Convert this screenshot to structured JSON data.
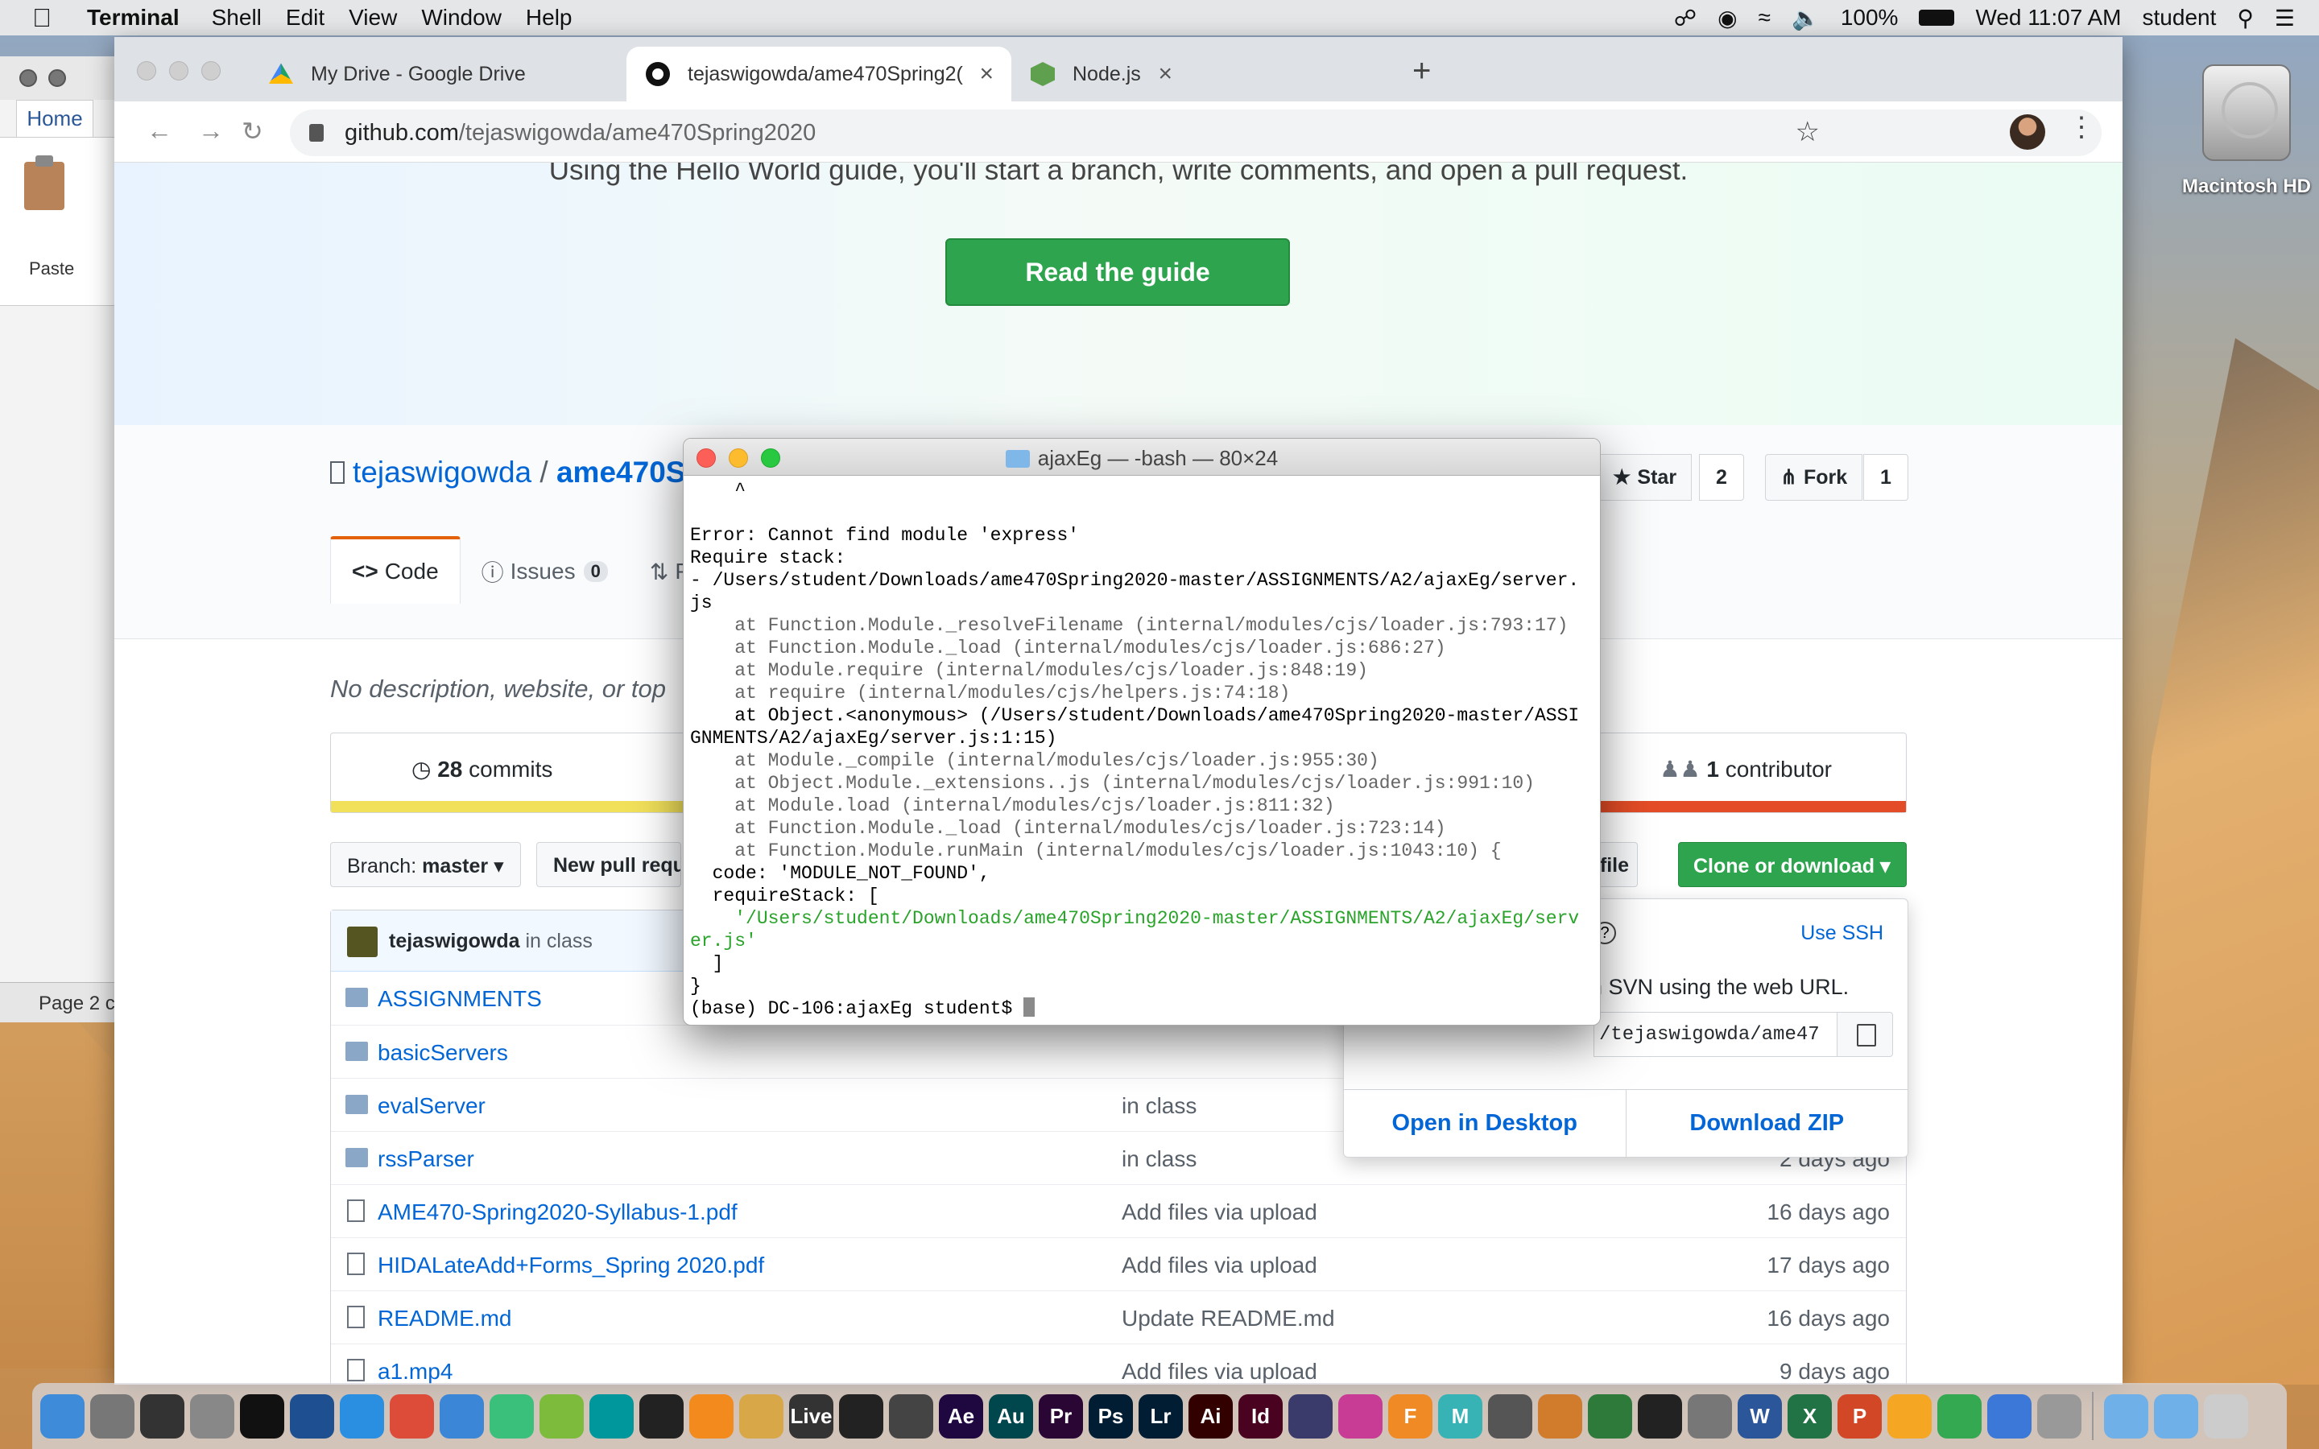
{
  "menubar": {
    "app": "Terminal",
    "items": [
      "Shell",
      "Edit",
      "View",
      "Window",
      "Help"
    ],
    "battery": "100%",
    "clock": "Wed 11:07 AM",
    "user": "student"
  },
  "word": {
    "home_tab": "Home",
    "paste": "Paste",
    "page_label": "Page 2 c"
  },
  "desktop": {
    "hd_label": "Macintosh HD"
  },
  "browser": {
    "tabs": [
      {
        "title": "My Drive - Google Drive"
      },
      {
        "title": "tejaswigowda/ame470Spring2("
      },
      {
        "title": "Node.js"
      }
    ],
    "url_host": "github.com",
    "url_path": "/tejaswigowda/ame470Spring2020"
  },
  "github": {
    "hero_sub": "Using the Hello World guide, you'll start a branch, write comments, and open a pull request.",
    "guide_button": "Read the guide",
    "owner": "tejaswigowda",
    "slash": "/",
    "repo_partial": "ame470S",
    "star_label": "Star",
    "star_count": "2",
    "fork_label": "Fork",
    "fork_count": "1",
    "tabs": {
      "code": "Code",
      "issues": "Issues",
      "issues_count": "0",
      "pulls_partial": "P"
    },
    "description": "No description, website, or top",
    "commits_count": "28",
    "commits_label": "commits",
    "contrib_count": "1",
    "contrib_label": "contributor",
    "branch_label": "Branch:",
    "branch_name": "master",
    "new_pr": "New pull requ",
    "find_file": "d file",
    "clone_button": "Clone or download",
    "commit_author": "tejaswigowda",
    "commit_msg": "in class",
    "files": [
      {
        "name": "ASSIGNMENTS",
        "type": "dir",
        "msg": "",
        "age": ""
      },
      {
        "name": "basicServers",
        "type": "dir",
        "msg": "",
        "age": ""
      },
      {
        "name": "evalServer",
        "type": "dir",
        "msg": "in class",
        "age": ""
      },
      {
        "name": "rssParser",
        "type": "dir",
        "msg": "in class",
        "age": "2 days ago"
      },
      {
        "name": "AME470-Spring2020-Syllabus-1.pdf",
        "type": "file",
        "msg": "Add files via upload",
        "age": "16 days ago"
      },
      {
        "name": "HIDALateAdd+Forms_Spring 2020.pdf",
        "type": "file",
        "msg": "Add files via upload",
        "age": "17 days ago"
      },
      {
        "name": "README.md",
        "type": "file",
        "msg": "Update README.md",
        "age": "16 days ago"
      },
      {
        "name": "a1.mp4",
        "type": "file",
        "msg": "Add files via upload",
        "age": "9 days ago"
      }
    ],
    "clone": {
      "use_ssh": "Use SSH",
      "svn_text": "n SVN using the web URL.",
      "url_value": "/tejaswigowda/ame47",
      "open_desktop": "Open in Desktop",
      "download_zip": "Download ZIP"
    },
    "lang_colors": [
      "#f1e05a",
      "#e34c26"
    ]
  },
  "terminal": {
    "title": "ajaxEg — -bash — 80×24",
    "lines": [
      {
        "t": "    ^",
        "c": ""
      },
      {
        "t": "",
        "c": ""
      },
      {
        "t": "Error: Cannot find module 'express'",
        "c": ""
      },
      {
        "t": "Require stack:",
        "c": ""
      },
      {
        "t": "- /Users/student/Downloads/ame470Spring2020-master/ASSIGNMENTS/A2/ajaxEg/server.",
        "c": ""
      },
      {
        "t": "js",
        "c": ""
      },
      {
        "t": "    at Function.Module._resolveFilename (internal/modules/cjs/loader.js:793:17)",
        "c": "gray"
      },
      {
        "t": "    at Function.Module._load (internal/modules/cjs/loader.js:686:27)",
        "c": "gray"
      },
      {
        "t": "    at Module.require (internal/modules/cjs/loader.js:848:19)",
        "c": "gray"
      },
      {
        "t": "    at require (internal/modules/cjs/helpers.js:74:18)",
        "c": "gray"
      },
      {
        "t": "    at Object.<anonymous> (/Users/student/Downloads/ame470Spring2020-master/ASSI",
        "c": ""
      },
      {
        "t": "GNMENTS/A2/ajaxEg/server.js:1:15)",
        "c": ""
      },
      {
        "t": "    at Module._compile (internal/modules/cjs/loader.js:955:30)",
        "c": "gray"
      },
      {
        "t": "    at Object.Module._extensions..js (internal/modules/cjs/loader.js:991:10)",
        "c": "gray"
      },
      {
        "t": "    at Module.load (internal/modules/cjs/loader.js:811:32)",
        "c": "gray"
      },
      {
        "t": "    at Function.Module._load (internal/modules/cjs/loader.js:723:14)",
        "c": "gray"
      },
      {
        "t": "    at Function.Module.runMain (internal/modules/cjs/loader.js:1043:10) {",
        "c": "gray"
      },
      {
        "t": "  code: 'MODULE_NOT_FOUND',",
        "c": ""
      },
      {
        "t": "  requireStack: [",
        "c": ""
      },
      {
        "t": "    '/Users/student/Downloads/ame470Spring2020-master/ASSIGNMENTS/A2/ajaxEg/serv",
        "c": "green"
      },
      {
        "t": "er.js'",
        "c": "green"
      },
      {
        "t": "  ]",
        "c": ""
      },
      {
        "t": "}",
        "c": ""
      }
    ],
    "prompt": "(base) DC-106:ajaxEg student$ "
  },
  "dock": [
    {
      "name": "finder",
      "color": "#3d8bd9",
      "label": ""
    },
    {
      "name": "launchpad",
      "color": "#777777",
      "label": ""
    },
    {
      "name": "mission-control",
      "color": "#333333",
      "label": ""
    },
    {
      "name": "system-preferences",
      "color": "#888888",
      "label": ""
    },
    {
      "name": "terminal",
      "color": "#111111",
      "label": ""
    },
    {
      "name": "sourcetree",
      "color": "#1d4f91",
      "label": ""
    },
    {
      "name": "safari",
      "color": "#2a8fe0",
      "label": ""
    },
    {
      "name": "chrome",
      "color": "#dd4b39",
      "label": ""
    },
    {
      "name": "xcode",
      "color": "#3b86d6",
      "label": ""
    },
    {
      "name": "atom",
      "color": "#3ac07b",
      "label": ""
    },
    {
      "name": "android-studio",
      "color": "#7dbb3d",
      "label": ""
    },
    {
      "name": "arduino",
      "color": "#00979c",
      "label": ""
    },
    {
      "name": "processing",
      "color": "#222222",
      "label": ""
    },
    {
      "name": "vlc",
      "color": "#f28a1e",
      "label": ""
    },
    {
      "name": "cyberduck",
      "color": "#d8a848",
      "label": ""
    },
    {
      "name": "ableton-live",
      "color": "#333333",
      "label": "Live"
    },
    {
      "name": "unity",
      "color": "#222222",
      "label": ""
    },
    {
      "name": "max",
      "color": "#444444",
      "label": ""
    },
    {
      "name": "after-effects",
      "color": "#1f0740",
      "label": "Ae"
    },
    {
      "name": "audition",
      "color": "#00474d",
      "label": "Au"
    },
    {
      "name": "premiere",
      "color": "#2a0634",
      "label": "Pr"
    },
    {
      "name": "photoshop",
      "color": "#001d34",
      "label": "Ps"
    },
    {
      "name": "lightroom",
      "color": "#001d34",
      "label": "Lr"
    },
    {
      "name": "illustrator",
      "color": "#330000",
      "label": "Ai"
    },
    {
      "name": "indesign",
      "color": "#49021f",
      "label": "Id"
    },
    {
      "name": "isadora",
      "color": "#3b3b6b",
      "label": ""
    },
    {
      "name": "isadora-2",
      "color": "#c83c96",
      "label": ""
    },
    {
      "name": "fusion-360",
      "color": "#f08a24",
      "label": "F"
    },
    {
      "name": "maya",
      "color": "#37b3b5",
      "label": "M"
    },
    {
      "name": "cinema",
      "color": "#555555",
      "label": ""
    },
    {
      "name": "garageband",
      "color": "#d07c2c",
      "label": ""
    },
    {
      "name": "wireshark",
      "color": "#2d7a3a",
      "label": ""
    },
    {
      "name": "final-cut",
      "color": "#222222",
      "label": ""
    },
    {
      "name": "compressor",
      "color": "#777777",
      "label": ""
    },
    {
      "name": "word",
      "color": "#2b579a",
      "label": "W"
    },
    {
      "name": "excel",
      "color": "#217346",
      "label": "X"
    },
    {
      "name": "powerpoint",
      "color": "#d24726",
      "label": "P"
    },
    {
      "name": "pages",
      "color": "#f5a623",
      "label": ""
    },
    {
      "name": "numbers",
      "color": "#35a852",
      "label": ""
    },
    {
      "name": "keynote",
      "color": "#3b78d8",
      "label": ""
    },
    {
      "name": "printer",
      "color": "#999999",
      "label": ""
    },
    {
      "name": "applications-folder",
      "color": "#6fb0e8",
      "label": ""
    },
    {
      "name": "downloads-folder",
      "color": "#6fb0e8",
      "label": ""
    },
    {
      "name": "trash",
      "color": "#cccccc",
      "label": ""
    }
  ]
}
